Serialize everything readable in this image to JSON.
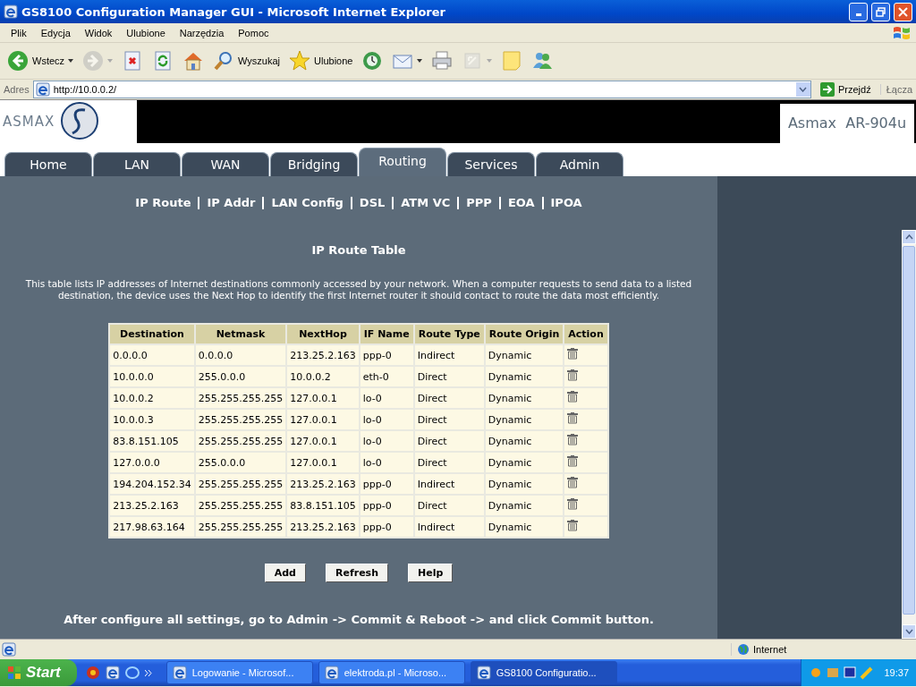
{
  "window": {
    "title": "GS8100 Configuration Manager GUI - Microsoft Internet Explorer"
  },
  "menu": [
    "Plik",
    "Edycja",
    "Widok",
    "Ulubione",
    "Narzędzia",
    "Pomoc"
  ],
  "toolbar": [
    {
      "kind": "back",
      "label": "Wstecz",
      "dropdown": true,
      "disabled": false
    },
    {
      "kind": "forward",
      "dropdown": true,
      "disabled": true
    },
    {
      "kind": "stop",
      "dropdown": false,
      "disabled": false
    },
    {
      "kind": "refresh",
      "dropdown": false,
      "disabled": false
    },
    {
      "kind": "home",
      "dropdown": false,
      "disabled": false
    },
    {
      "kind": "search",
      "label": "Wyszukaj",
      "dropdown": false,
      "disabled": false
    },
    {
      "kind": "favorites",
      "label": "Ulubione",
      "dropdown": false,
      "disabled": false
    },
    {
      "kind": "history",
      "dropdown": false,
      "disabled": false
    },
    {
      "kind": "mail",
      "dropdown": true,
      "disabled": false
    },
    {
      "kind": "print",
      "dropdown": false,
      "disabled": false
    },
    {
      "kind": "edit",
      "dropdown": true,
      "disabled": true
    },
    {
      "kind": "note",
      "dropdown": false,
      "disabled": false
    },
    {
      "kind": "messenger",
      "dropdown": false,
      "disabled": false
    }
  ],
  "address": {
    "label": "Adres",
    "value": "http://10.0.0.2/",
    "go": "Przejdź",
    "links": "Łącza"
  },
  "page": {
    "brand": "ASMAX",
    "model": "Asmax  AR-904u",
    "tabs": [
      {
        "label": "Home",
        "selected": false
      },
      {
        "label": "LAN",
        "selected": false
      },
      {
        "label": "WAN",
        "selected": false
      },
      {
        "label": "Bridging",
        "selected": false
      },
      {
        "label": "Routing",
        "selected": true
      },
      {
        "label": "Services",
        "selected": false
      },
      {
        "label": "Admin",
        "selected": false
      }
    ],
    "subnav": [
      "IP Route",
      "IP Addr",
      "LAN Config",
      "DSL",
      "ATM VC",
      "PPP",
      "EOA",
      "IPOA"
    ],
    "heading": "IP Route Table",
    "description": "This table lists IP addresses of Internet destinations commonly accessed by your network. When a computer requests to send data to a listed destination, the device uses the Next Hop to identify the first Internet router it should contact to route the data most efficiently.",
    "table": {
      "columns": [
        "Destination",
        "Netmask",
        "NextHop",
        "IF Name",
        "Route Type",
        "Route Origin",
        "Action"
      ],
      "rows": [
        [
          "0.0.0.0",
          "0.0.0.0",
          "213.25.2.163",
          "ppp-0",
          "Indirect",
          "Dynamic"
        ],
        [
          "10.0.0.0",
          "255.0.0.0",
          "10.0.0.2",
          "eth-0",
          "Direct",
          "Dynamic"
        ],
        [
          "10.0.0.2",
          "255.255.255.255",
          "127.0.0.1",
          "lo-0",
          "Direct",
          "Dynamic"
        ],
        [
          "10.0.0.3",
          "255.255.255.255",
          "127.0.0.1",
          "lo-0",
          "Direct",
          "Dynamic"
        ],
        [
          "83.8.151.105",
          "255.255.255.255",
          "127.0.0.1",
          "lo-0",
          "Direct",
          "Dynamic"
        ],
        [
          "127.0.0.0",
          "255.0.0.0",
          "127.0.0.1",
          "lo-0",
          "Direct",
          "Dynamic"
        ],
        [
          "194.204.152.34",
          "255.255.255.255",
          "213.25.2.163",
          "ppp-0",
          "Indirect",
          "Dynamic"
        ],
        [
          "213.25.2.163",
          "255.255.255.255",
          "83.8.151.105",
          "ppp-0",
          "Direct",
          "Dynamic"
        ],
        [
          "217.98.63.164",
          "255.255.255.255",
          "213.25.2.163",
          "ppp-0",
          "Indirect",
          "Dynamic"
        ]
      ]
    },
    "buttons": [
      "Add",
      "Refresh",
      "Help"
    ],
    "footer_note": "After configure all settings, go to Admin -> Commit & Reboot -> and click Commit button."
  },
  "status_bar": {
    "zone": "Internet"
  },
  "taskbar": {
    "start": "Start",
    "tasks": [
      {
        "label": "Logowanie - Microsof...",
        "selected": false
      },
      {
        "label": "elektroda.pl - Microso...",
        "selected": false
      },
      {
        "label": "GS8100 Configuratio...",
        "selected": true
      }
    ],
    "clock": "19:37"
  }
}
